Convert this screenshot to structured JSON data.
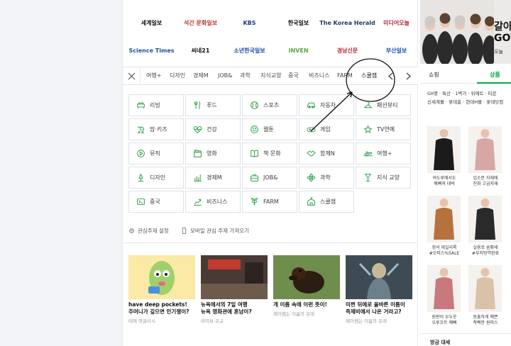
{
  "press": [
    "세계일보",
    "석간 문화일보",
    "KBS",
    "한국일보",
    "The Korea Herald",
    "미디어오늘",
    "Science Times",
    "씨네21",
    "소년한국일보",
    "INVEN",
    "경남신문",
    "부산일보"
  ],
  "tabs": {
    "items": [
      "여행+",
      "디자인",
      "경제M",
      "JOB&",
      "과학",
      "지식교양",
      "중국",
      "비즈니스",
      "FARM",
      "스쿨잼"
    ],
    "active_index": 9,
    "prev_label": "‹",
    "next_label": "›"
  },
  "themes": [
    {
      "label": "리빙",
      "icon": "couch-icon"
    },
    {
      "label": "푸드",
      "icon": "fork-knife-icon"
    },
    {
      "label": "스포츠",
      "icon": "baseball-icon"
    },
    {
      "label": "자동차",
      "icon": "car-icon"
    },
    {
      "label": "패션뷰티",
      "icon": "hanger-icon"
    },
    {
      "label": "맘·키즈",
      "icon": "stroller-icon"
    },
    {
      "label": "건강",
      "icon": "heart-pulse-icon"
    },
    {
      "label": "웹툰",
      "icon": "smile-icon"
    },
    {
      "label": "게임",
      "icon": "gamepad-icon"
    },
    {
      "label": "TV연예",
      "icon": "star-tv-icon"
    },
    {
      "label": "뮤직",
      "icon": "play-circle-icon"
    },
    {
      "label": "영화",
      "icon": "clapperboard-icon"
    },
    {
      "label": "책 문화",
      "icon": "open-book-icon"
    },
    {
      "label": "함께N",
      "icon": "handshake-icon"
    },
    {
      "label": "여행+",
      "icon": "airplane-icon"
    },
    {
      "label": "디자인",
      "icon": "design-pen-icon"
    },
    {
      "label": "경제M",
      "icon": "bar-chart-icon"
    },
    {
      "label": "JOB&",
      "icon": "briefcase-icon"
    },
    {
      "label": "과학",
      "icon": "atom-icon"
    },
    {
      "label": "지식 교양",
      "icon": "compass-icon"
    },
    {
      "label": "중국",
      "icon": "china-icon"
    },
    {
      "label": "비즈니스",
      "icon": "business-chart-icon"
    },
    {
      "label": "FARM",
      "icon": "farm-leaf-icon"
    },
    {
      "label": "스쿨잼",
      "icon": "school-icon"
    }
  ],
  "footer": {
    "settings": "관심주제 설정",
    "mobile": "모바일 관심 주제 가져오기"
  },
  "cards": [
    {
      "title1": "have deep pockets!",
      "title2": "주머니가 깊으면 인기쟁이?",
      "source": "테헤 영글리시",
      "color": "#fbe9a6"
    },
    {
      "title1": "뉴욕에서의 7일 여행",
      "title2": "뉴욕 영화관에 혼남이?",
      "source": "라이브 유교",
      "color": "#4a3a36"
    },
    {
      "title1": "개 이름 속에 이런 뜻이!",
      "title2": "",
      "source": "제이쌤는 이름의 유래",
      "color": "#6f8e4e"
    },
    {
      "title1": "미쩐 뒤에로 올바른 이름이",
      "title2": "즉제비에서 나온 거라고?",
      "source": "제이쌤는 이름의 유래",
      "color": "#3e4b55"
    }
  ],
  "right": {
    "banner_line1": "갈아",
    "banner_line2": "GOT",
    "banner_sub": "오늘 ",
    "shop_tabs": [
      "쇼핑",
      "상품"
    ],
    "shop_active": 1,
    "shop_cats": [
      "GII랫 · 특산 · 1벽가 · 위에트 · 티몬",
      "신세계몰 · 롯데홈 · 현대H몰 · 롯데닷컴"
    ],
    "products": [
      {
        "cap1": "여도루에서도",
        "cap2": "예뻐져 대박",
        "color": "#1b1b1b"
      },
      {
        "cap1": "입소문 자체에",
        "cap2": "진화 고급자재",
        "color": "#d7a7a6"
      },
      {
        "cap1": "정석 데일리룩",
        "cap2": "#오피스%SALE",
        "color": "#b6713d"
      },
      {
        "cap1": "실용로 숨쀼세",
        "cap2": "#부지방역완료",
        "color": "#2a2a2a"
      },
      {
        "cap1": "원판이 우두웃",
        "cap2": "오루꼬트 예뻐",
        "color": "#c9787b"
      },
      {
        "cap1": "동흥하게 예쁜",
        "cap2": "착빡한 원피스",
        "color": "#d9c2a8"
      }
    ],
    "bottom_label": "방금 대세"
  }
}
